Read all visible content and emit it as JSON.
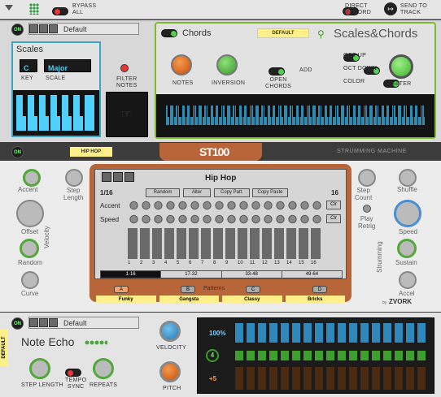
{
  "topbar": {
    "bypass_label": "BYPASS\nALL",
    "direct_record_label": "DIRECT\nRECORD",
    "send_to_track_label": "SEND TO\nTRACK"
  },
  "scales_device": {
    "on_label": "ON",
    "preset": "Default",
    "scales_title": "Scales",
    "key_value": "C",
    "scale_value": "Major",
    "key_label": "KEY",
    "scale_label": "SCALE",
    "filter_notes_label": "FILTER\nNOTES",
    "chords_title": "Chords",
    "chords_preset": "DEFAULT",
    "brand": "Scales&Chords",
    "notes_label": "NOTES",
    "inversion_label": "INVERSION",
    "open_chords_label": "OPEN\nCHORDS",
    "add_label": "ADD",
    "oct_up_label": "OCT UP",
    "oct_down_label": "OCT DOWN",
    "color_label": "COLOR",
    "alter_label": "ALTER"
  },
  "st100": {
    "on_label": "ON",
    "preset_tag": "HIP HOP",
    "logo": "ST100",
    "subtitle": "STRUMMING MACHINE",
    "accent_label": "Accent",
    "step_length_label": "Step\nLength",
    "offset_label": "Offset",
    "random_label": "Random",
    "curve_label": "Curve",
    "velocity_label": "Velocity",
    "step_count_label": "Step\nCount",
    "shuffle_label": "Shuffle",
    "play_retrig_label": "Play\nRetrig",
    "speed_knob_label": "Speed",
    "sustain_label": "Sustain",
    "accel_label": "Accel",
    "strumming_label": "Strumming",
    "screen_title": "Hip Hop",
    "step_div": "1/16",
    "buttons": [
      "Random",
      "Alter",
      "Copy Patt.",
      "Copy Paste"
    ],
    "steps_total": "16",
    "row_accent_label": "Accent",
    "row_speed_label": "Speed",
    "clr_label": "Clr",
    "step_numbers": [
      "1",
      "2",
      "3",
      "4",
      "5",
      "6",
      "7",
      "8",
      "9",
      "10",
      "11",
      "12",
      "13",
      "14",
      "15",
      "16"
    ],
    "pages": [
      "1-16",
      "17-32",
      "33-48",
      "49-64"
    ],
    "patterns_label": "Patterns",
    "pattern_letters": [
      "A",
      "B",
      "C",
      "D"
    ],
    "pattern_names": [
      "Funky",
      "Gangsta",
      "Classy",
      "Bricks"
    ],
    "maker": "ZVORK",
    "maker_prefix": "by"
  },
  "note_echo": {
    "on_label": "ON",
    "preset": "Default",
    "side_tag": "DEFAULT",
    "title": "Note Echo",
    "step_length_label": "STEP LENGTH",
    "tempo_sync_label": "TEMPO\nSYNC",
    "repeats_label": "REPEATS",
    "velocity_label": "VELOCITY",
    "pitch_label": "PITCH",
    "display_velocity": "100%",
    "display_repeats": "4",
    "display_pitch": "+5"
  }
}
